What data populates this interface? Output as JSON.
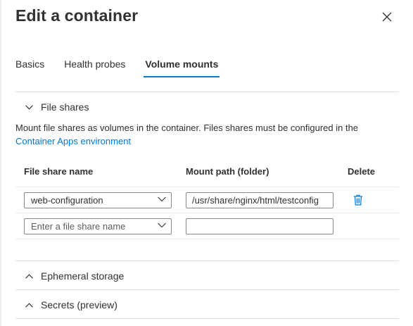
{
  "panel": {
    "title": "Edit a container"
  },
  "tabs": [
    {
      "label": "Basics"
    },
    {
      "label": "Health probes"
    },
    {
      "label": "Volume mounts"
    }
  ],
  "file_shares": {
    "heading": "File shares",
    "description": "Mount file shares as volumes in the container. Files shares must be configured in the",
    "link_text": "Container Apps environment",
    "columns": [
      "File share name",
      "Mount path (folder)",
      "Delete"
    ],
    "rows": [
      {
        "share": "web-configuration",
        "mount_path": "/usr/share/nginx/html/testconfig"
      }
    ],
    "new_row": {
      "share_placeholder": "Enter a file share name",
      "mount_path": ""
    }
  },
  "ephemeral_storage": {
    "heading": "Ephemeral storage"
  },
  "secrets": {
    "heading": "Secrets (preview)"
  },
  "colors": {
    "accent": "#0078d4",
    "text": "#323130",
    "border": "#8a8886",
    "divider": "#e1dfdd"
  }
}
